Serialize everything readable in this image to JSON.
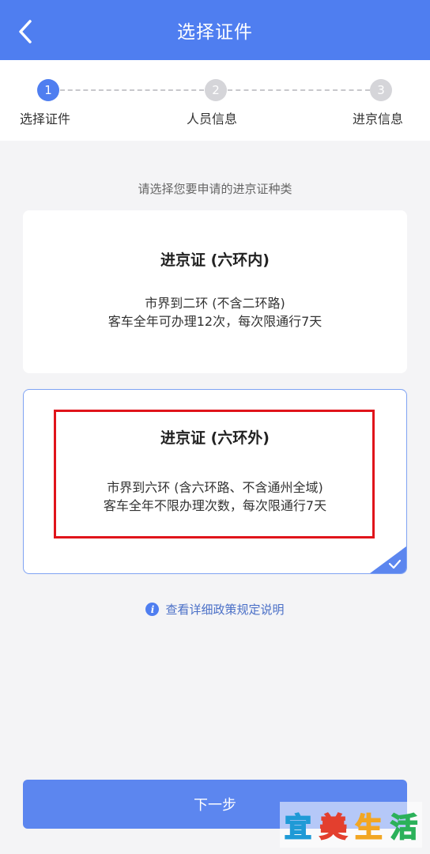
{
  "header": {
    "title": "选择证件"
  },
  "stepper": {
    "steps": [
      {
        "number": "1",
        "label": "选择证件"
      },
      {
        "number": "2",
        "label": "人员信息"
      },
      {
        "number": "3",
        "label": "进京信息"
      }
    ]
  },
  "instruction": "请选择您要申请的进京证种类",
  "cards": [
    {
      "title": "进京证 (六环内)",
      "line1": "市界到二环 (不含二环路)",
      "line2": "客车全年可办理12次，每次限通行7天",
      "selected": false
    },
    {
      "title": "进京证 (六环外)",
      "line1": "市界到六环 (含六环路、不含通州全域)",
      "line2": "客车全年不限办理次数，每次限通行7天",
      "selected": true
    }
  ],
  "policy_link": "查看详细政策规定说明",
  "next_button": "下一步",
  "watermark": {
    "chars": [
      "宜",
      "美",
      "生",
      "活"
    ],
    "colors": [
      "#1f9ad6",
      "#e33f2e",
      "#f2a623",
      "#2bb15a"
    ]
  },
  "colors": {
    "brand": "#4f7ef0",
    "highlight": "#e0141b"
  }
}
